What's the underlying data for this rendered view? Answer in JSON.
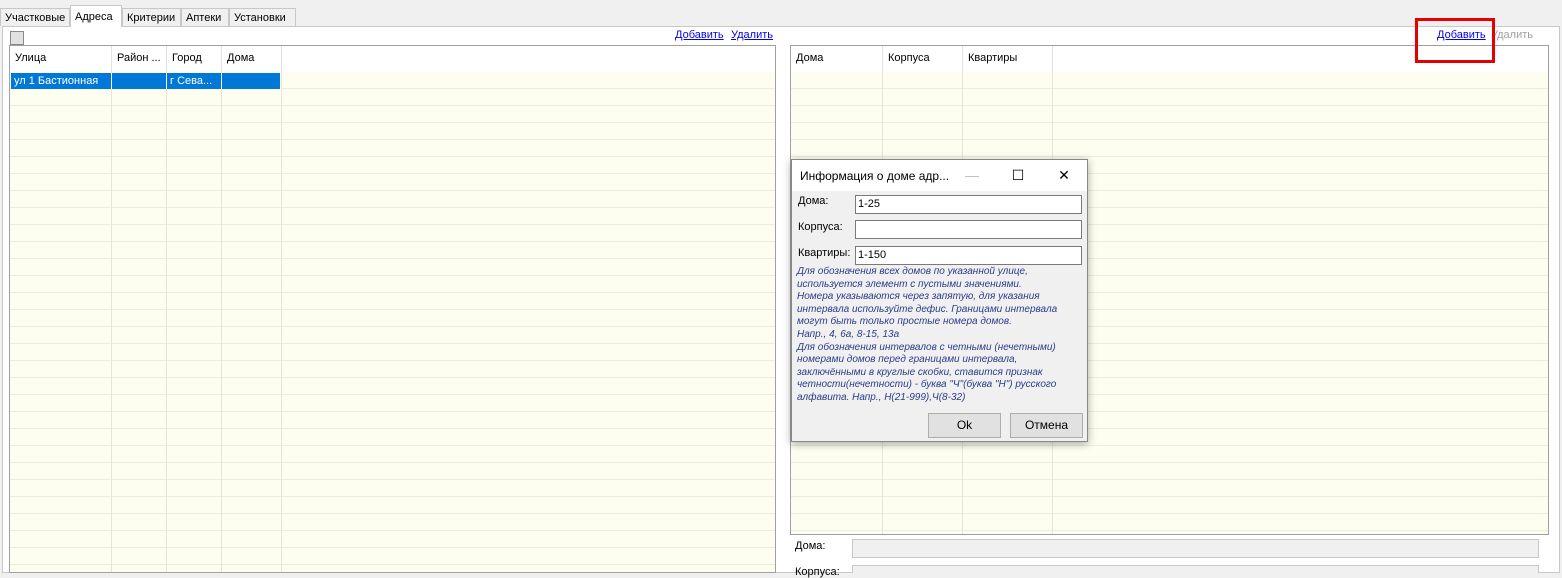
{
  "tabs": [
    {
      "label": "Участковые"
    },
    {
      "label": "Адреса"
    },
    {
      "label": "Критерии"
    },
    {
      "label": "Аптеки"
    },
    {
      "label": "Установки"
    }
  ],
  "left_panel": {
    "add_link": "Добавить",
    "delete_link": "Удалить",
    "columns": [
      "Улица",
      "Район ...",
      "Город",
      "Дома"
    ],
    "selected_row": [
      "ул 1 Бастионная",
      "",
      "г Сева...",
      ""
    ]
  },
  "right_panel": {
    "add_link": "Добавить",
    "delete_link": "Удалить",
    "columns": [
      "Дома",
      "Корпуса",
      "Квартиры"
    ],
    "bottom_labels": {
      "houses": "Дома:",
      "corpus": "Корпуса:"
    }
  },
  "dialog": {
    "title": "Информация о доме адр...",
    "minimize_icon": "—",
    "maximize_icon": "☐",
    "close_icon": "✕",
    "houses_label": "Дома:",
    "houses_value": "1-25",
    "corpus_label": "Корпуса:",
    "corpus_value": "",
    "apartments_label": "Квартиры:",
    "apartments_value": "1-150",
    "help_text": "Для обозначения всех домов по указанной улице,\nиспользуется элемент с пустыми значениями.\nНомера указываются через запятую, для указания\nинтервала используйте дефис. Границами интервала\nмогут быть только простые номера домов.\nНапр., 4, 6а, 8-15, 13а\nДля обозначения интервалов с четными (нечетными)\nномерами домов перед границами интервала,\nзаключёнными в круглые скобки, ставится признак\nчетности(нечетности) -  буква \"Ч\"(буква \"Н\") русского\nалфавита. Напр., Н(21-999),Ч(8-32)",
    "ok_label": "Ok",
    "cancel_label": "Отмена"
  },
  "colors": {
    "selection": "#0078d7",
    "grid_background": "#fefef0",
    "highlight_box": "#e60000",
    "help_text": "#2a3c8a",
    "link": "#0000ee"
  }
}
